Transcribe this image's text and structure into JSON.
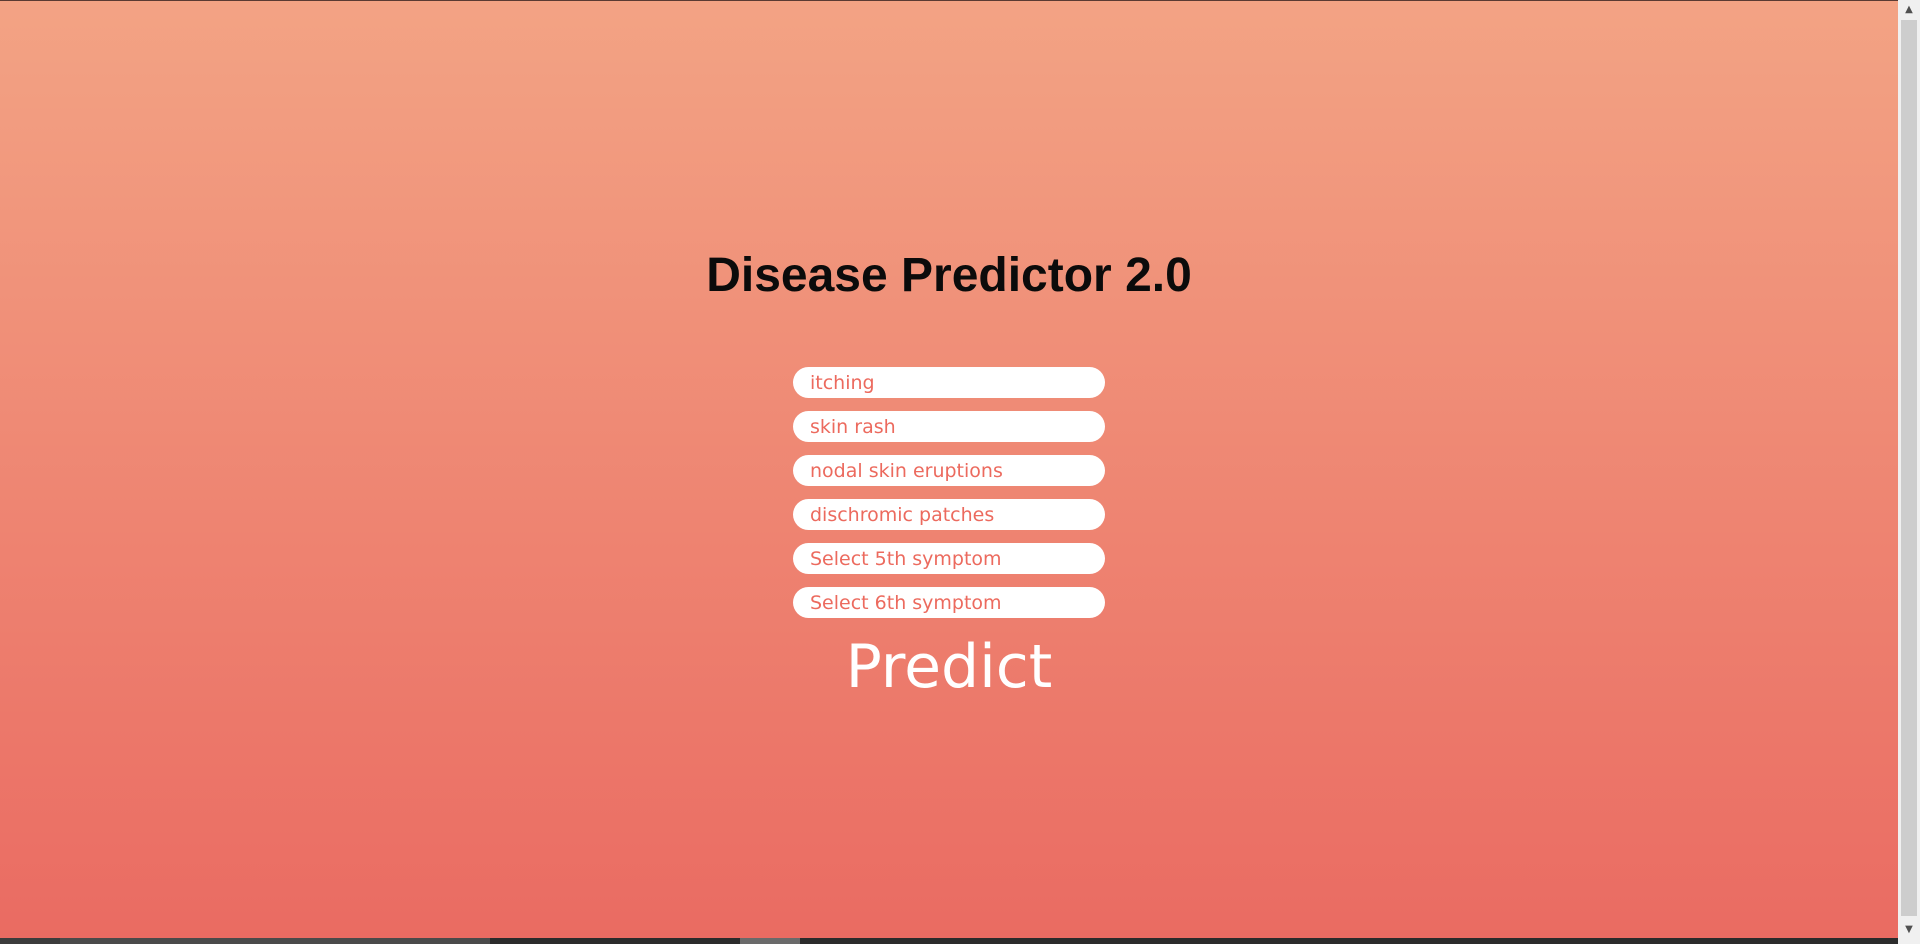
{
  "app": {
    "title": "Disease Predictor 2.0"
  },
  "form": {
    "symptoms": [
      {
        "value": "itching"
      },
      {
        "value": "skin rash"
      },
      {
        "value": "nodal skin eruptions"
      },
      {
        "value": "dischromic patches"
      },
      {
        "value": "Select 5th symptom"
      },
      {
        "value": "Select 6th symptom"
      }
    ],
    "predict_label": "Predict"
  },
  "scrollbar": {
    "up_icon": "chevron-up-icon",
    "down_icon": "chevron-down-icon"
  },
  "colors": {
    "gradient_top": "#f3a384",
    "gradient_bottom": "#ea6b62",
    "symptom_text": "#ec6a5e",
    "title_text": "#0b0b0b",
    "predict_text": "#ffffff"
  }
}
